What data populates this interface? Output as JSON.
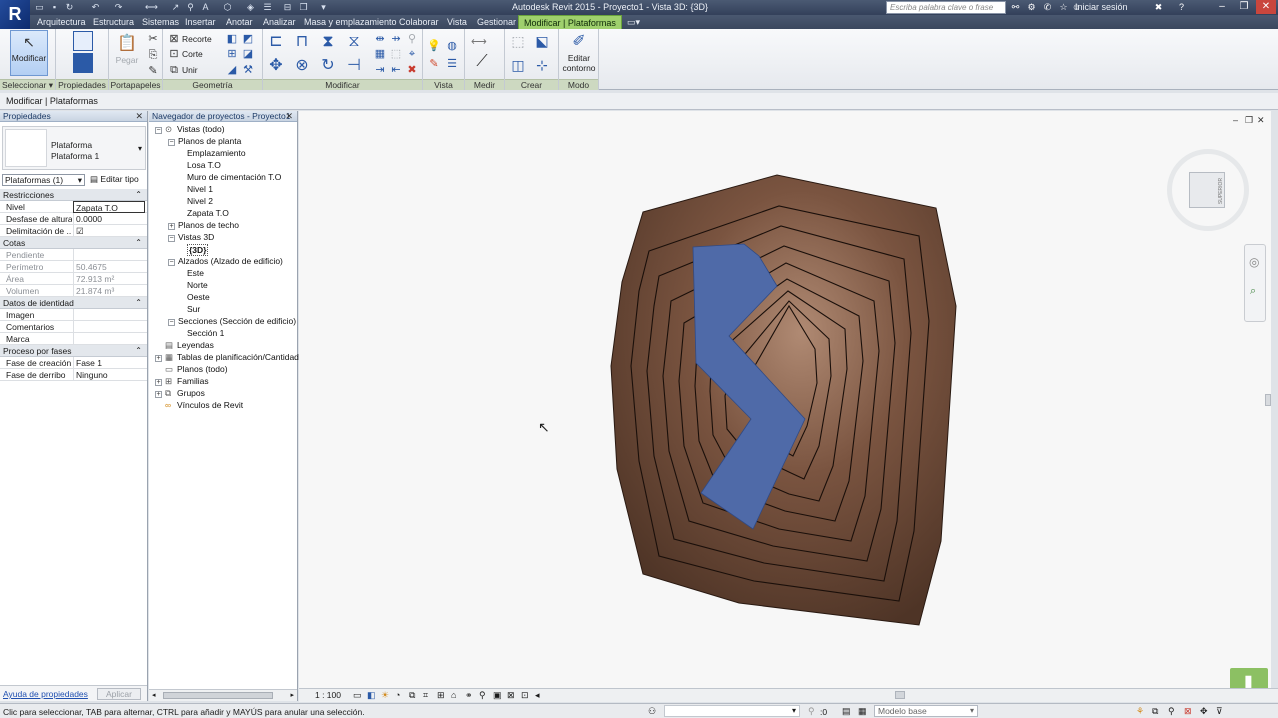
{
  "window": {
    "title": "Autodesk Revit 2015 -   Proyecto1 - Vista 3D: {3D}",
    "search_placeholder": "Escriba palabra clave o frase",
    "signin": "Iniciar sesión",
    "logo": "R"
  },
  "tabs": [
    "Arquitectura",
    "Estructura",
    "Sistemas",
    "Insertar",
    "Anotar",
    "Analizar",
    "Masa y emplazamiento",
    "Colaborar",
    "Vista",
    "Gestionar",
    "Modificar | Plataformas"
  ],
  "active_tab": "Modificar | Plataformas",
  "ribbon": {
    "panels": {
      "select": "Seleccionar",
      "properties": "Propiedades",
      "clipboard": "Portapapeles",
      "geometry": "Geometría",
      "modify": "Modificar",
      "view": "Vista",
      "measure": "Medir",
      "create": "Crear",
      "mode": "Modo"
    },
    "buttons": {
      "modify": "Modificar",
      "paste": "Pegar",
      "cope": "Recorte",
      "cut": "Corte",
      "join": "Unir",
      "edit_boundary_1": "Editar",
      "edit_boundary_2": "contorno"
    },
    "accent": "#9fd06d"
  },
  "context_bar": "Modificar | Plataformas",
  "properties": {
    "header": "Propiedades",
    "type_family": "Plataforma",
    "type_name": "Plataforma 1",
    "instance_selector": "Plataformas (1)",
    "edit_type": "Editar tipo",
    "groups": [
      {
        "name": "Restricciones",
        "rows": [
          {
            "name": "Nivel",
            "value": "Zapata T.O",
            "dim": false
          },
          {
            "name": "Desfase de altura...",
            "value": "0.0000",
            "dim": false
          },
          {
            "name": "Delimitación de ...",
            "value": "☑",
            "dim": false
          }
        ]
      },
      {
        "name": "Cotas",
        "rows": [
          {
            "name": "Pendiente",
            "value": "",
            "dim": true
          },
          {
            "name": "Perímetro",
            "value": "50.4675",
            "dim": true
          },
          {
            "name": "Área",
            "value": "72.913 m²",
            "dim": true
          },
          {
            "name": "Volumen",
            "value": "21.874 m³",
            "dim": true
          }
        ]
      },
      {
        "name": "Datos de identidad",
        "rows": [
          {
            "name": "Imagen",
            "value": "",
            "dim": false
          },
          {
            "name": "Comentarios",
            "value": "",
            "dim": false
          },
          {
            "name": "Marca",
            "value": "",
            "dim": false
          }
        ]
      },
      {
        "name": "Proceso por fases",
        "rows": [
          {
            "name": "Fase de creación",
            "value": "Fase 1",
            "dim": false
          },
          {
            "name": "Fase de derribo",
            "value": "Ninguno",
            "dim": false
          }
        ]
      }
    ],
    "help_link": "Ayuda de propiedades",
    "apply": "Aplicar"
  },
  "browser": {
    "header": "Navegador de proyectos - Proyecto1",
    "nodes": [
      {
        "label": "Vistas (todo)",
        "level": 0,
        "toggle": "−",
        "icon": "views"
      },
      {
        "label": "Planos de planta",
        "level": 1,
        "toggle": "−"
      },
      {
        "label": "Emplazamiento",
        "level": 2
      },
      {
        "label": "Losa T.O",
        "level": 2
      },
      {
        "label": "Muro de cimentación T.O",
        "level": 2
      },
      {
        "label": "Nivel 1",
        "level": 2
      },
      {
        "label": "Nivel 2",
        "level": 2
      },
      {
        "label": "Zapata T.O",
        "level": 2
      },
      {
        "label": "Planos de techo",
        "level": 1,
        "toggle": "+"
      },
      {
        "label": "Vistas 3D",
        "level": 1,
        "toggle": "−"
      },
      {
        "label": "{3D}",
        "level": 2,
        "selected": true
      },
      {
        "label": "Alzados (Alzado de edificio)",
        "level": 1,
        "toggle": "−"
      },
      {
        "label": "Este",
        "level": 2
      },
      {
        "label": "Norte",
        "level": 2
      },
      {
        "label": "Oeste",
        "level": 2
      },
      {
        "label": "Sur",
        "level": 2
      },
      {
        "label": "Secciones (Sección de edificio)",
        "level": 1,
        "toggle": "−"
      },
      {
        "label": "Sección 1",
        "level": 2
      },
      {
        "label": "Leyendas",
        "level": 0,
        "icon": "legend"
      },
      {
        "label": "Tablas de planificación/Cantidades",
        "level": 0,
        "toggle": "+",
        "icon": "schedule"
      },
      {
        "label": "Planos (todo)",
        "level": 0,
        "icon": "sheet"
      },
      {
        "label": "Familias",
        "level": 0,
        "toggle": "+",
        "icon": "family"
      },
      {
        "label": "Grupos",
        "level": 0,
        "toggle": "+",
        "icon": "group"
      },
      {
        "label": "Vínculos de Revit",
        "level": 0,
        "icon": "link"
      }
    ]
  },
  "viewcube": {
    "label": "SUPERIOR"
  },
  "view_controls": {
    "scale": "1 : 100"
  },
  "status": {
    "message": "Clic para seleccionar, TAB para alternar, CTRL para añadir y MAYÚS para anular una selección.",
    "selection_count": ":0",
    "model": "Modelo base"
  },
  "colors": {
    "terrain": "#6d4a36",
    "pad": "#4f6aa8",
    "ribbon_accent": "#9fd06d"
  }
}
